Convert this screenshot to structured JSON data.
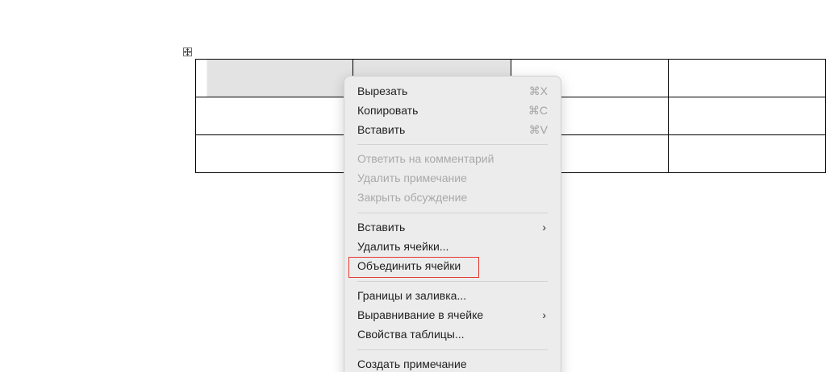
{
  "table": {
    "rows": 3,
    "columns": 4
  },
  "context_menu": {
    "items": [
      {
        "label": "Вырезать",
        "shortcut": "⌘X",
        "enabled": true
      },
      {
        "label": "Копировать",
        "shortcut": "⌘C",
        "enabled": true
      },
      {
        "label": "Вставить",
        "shortcut": "⌘V",
        "enabled": true
      },
      {
        "label": "Ответить на комментарий",
        "enabled": false
      },
      {
        "label": "Удалить примечание",
        "enabled": false
      },
      {
        "label": "Закрыть обсуждение",
        "enabled": false
      },
      {
        "label": "Вставить",
        "submenu": true,
        "enabled": true
      },
      {
        "label": "Удалить ячейки...",
        "enabled": true
      },
      {
        "label": "Объединить ячейки",
        "enabled": true,
        "highlighted": true
      },
      {
        "label": "Границы и заливка...",
        "enabled": true
      },
      {
        "label": "Выравнивание в ячейке",
        "submenu": true,
        "enabled": true
      },
      {
        "label": "Свойства таблицы...",
        "enabled": true
      },
      {
        "label": "Создать примечание",
        "enabled": true
      }
    ],
    "submenu_glyph": "›"
  },
  "colors": {
    "highlight": "#e2382f",
    "menu_background": "#ececec",
    "selected_cell": "#e3e3e3"
  }
}
